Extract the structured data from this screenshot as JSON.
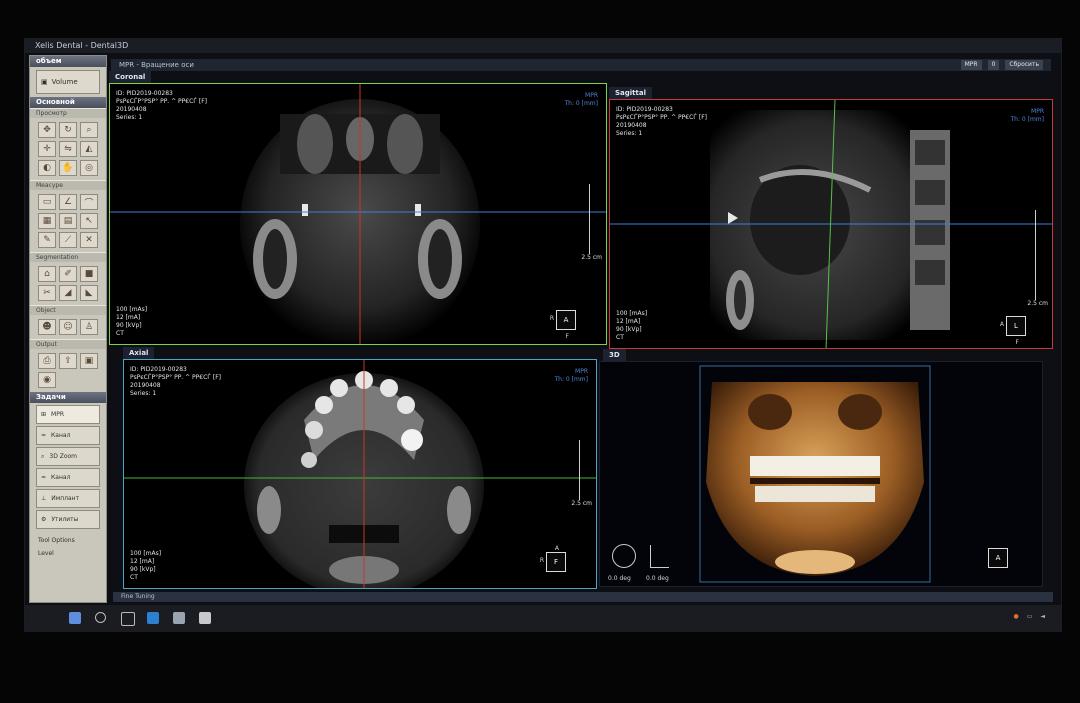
{
  "window": {
    "title": "Xelis Dental - Dental3D"
  },
  "mpr_bar": {
    "label": "MPR - Вращение оси",
    "tool1": "MPR",
    "tool2": "0",
    "reset": "Сбросить"
  },
  "sidebar": {
    "top_section": "объем",
    "volume_button": "Volume",
    "main_section": "Основной",
    "view_sub": "Просмотр",
    "measure_sub": "Меасуре",
    "segmentation_sub": "Segmentation",
    "object_sub": "Object",
    "output_sub": "Output",
    "tasks_section": "Задачи",
    "tasks": [
      "MPR",
      "Канал",
      "3D Zoom",
      "Канал",
      "Имплант",
      "Утилиты"
    ],
    "tool_options": "Tool Options",
    "level_label": "Level"
  },
  "viewports": {
    "coronal": {
      "title": "Coronal",
      "info": [
        "ID: PID2019-00283",
        "РѕРєСЃР°РЅР° РР. ^ РР€СЃ [F]",
        "20190408",
        "Series: 1"
      ],
      "right_info": [
        "MPR",
        "Th: 0 [mm]"
      ],
      "tech": [
        "100 [mAs]",
        "12 [mA]",
        "90 [kVp]",
        "CT"
      ],
      "scale": "2.5 cm",
      "orient_center": "A",
      "orient_left": "R",
      "orient_bottom": "F"
    },
    "sagittal": {
      "title": "Sagittal",
      "info": [
        "ID: PID2019-00283",
        "РѕРєСЃР°РЅР° РР. ^ РР€СЃ [F]",
        "20190408",
        "Series: 1"
      ],
      "right_info": [
        "MPR",
        "Th: 0 [mm]"
      ],
      "tech": [
        "100 [mAs]",
        "12 [mA]",
        "90 [kVp]",
        "CT"
      ],
      "scale": "2.5 cm",
      "orient_center": "L",
      "orient_left": "A",
      "orient_bottom": "F"
    },
    "axial": {
      "title": "Axial",
      "info": [
        "ID: PID2019-00283",
        "РѕРєСЃР°РЅР° РР. ^ РР€СЃ [F]",
        "20190408",
        "Series: 1"
      ],
      "right_info": [
        "MPR",
        "Th: 0 [mm]"
      ],
      "tech": [
        "100 [mAs]",
        "12 [mA]",
        "90 [kVp]",
        "CT"
      ],
      "scale": "2.5 cm",
      "orient_center": "F",
      "orient_left": "R",
      "orient_top": "A"
    },
    "threed": {
      "title": "3D",
      "rot1": "0.0 deg",
      "rot2": "0.0 deg",
      "orient_center": "A"
    }
  },
  "status_strip": "Fine Tuning"
}
